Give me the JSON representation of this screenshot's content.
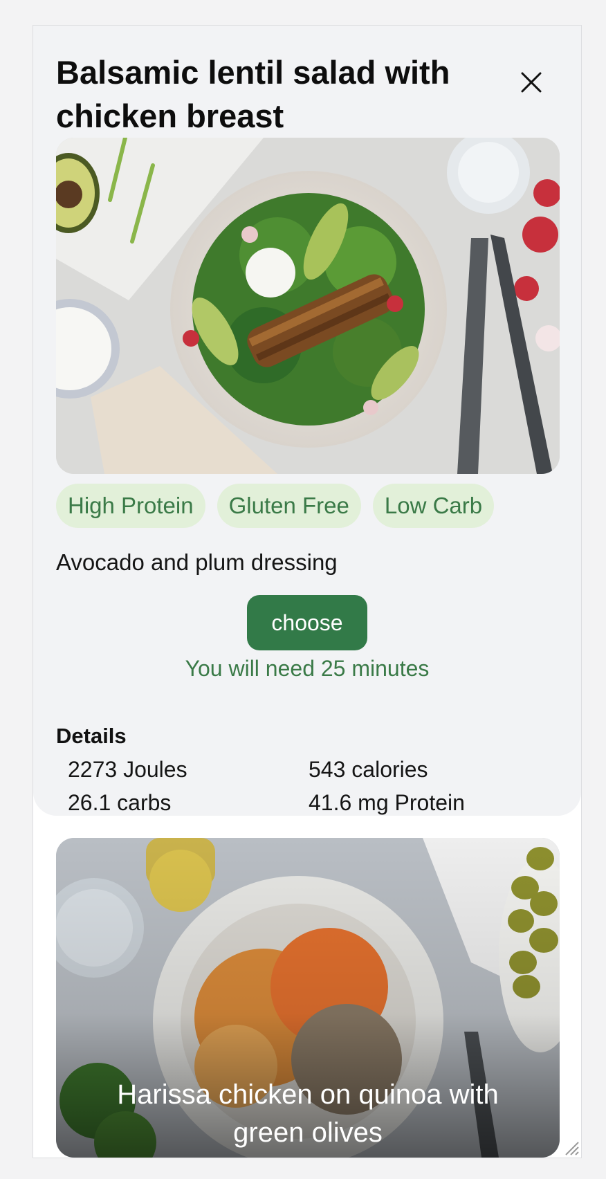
{
  "recipe": {
    "title": "Balsamic lentil salad with chicken breast",
    "tags": [
      "High Protein",
      "Gluten Free",
      "Low Carb"
    ],
    "subtitle": "Avocado and plum dressing",
    "choose_label": "choose",
    "time_note": "You will need 25 minutes",
    "details_heading": "Details",
    "nutrition": {
      "joules": "2273 Joules",
      "calories": "543 calories",
      "carbs": "26.1 carbs",
      "protein": "41.6 mg Protein"
    }
  },
  "next_recipe": {
    "title": "Harissa chicken on quinoa with green olives"
  },
  "icons": {
    "close": "close-icon",
    "resize": "resize-grip-icon"
  },
  "colors": {
    "accent_green": "#327a48",
    "tag_bg": "#e2f0d9",
    "tag_text": "#3a7a47",
    "card_bg": "#f2f3f5"
  }
}
